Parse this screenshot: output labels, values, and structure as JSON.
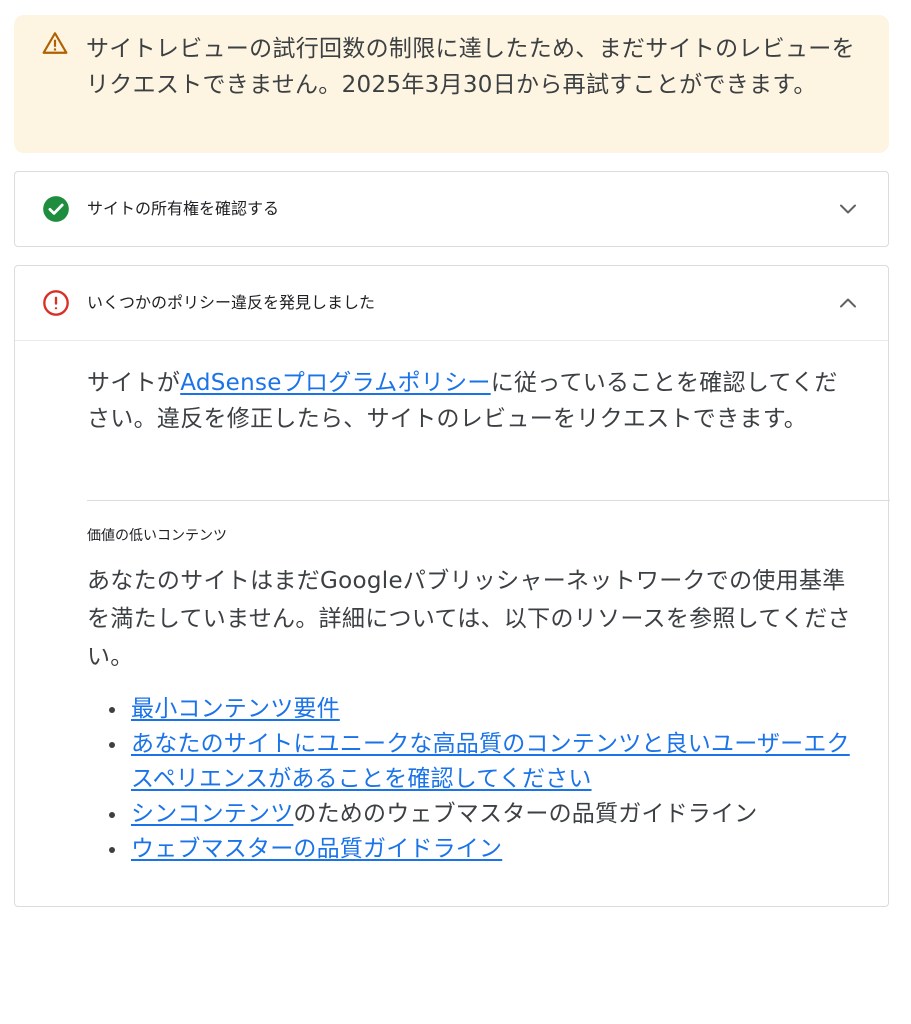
{
  "banner": {
    "icon": "warning-triangle-icon",
    "text": "サイトレビューの試行回数の制限に達したため、まだサイトのレビューをリクエストできません。2025年3月30日から再試すことができます。",
    "color": "#fdf5e1",
    "icon_color": "#b06000"
  },
  "ownership_panel": {
    "icon": "check-circle-icon",
    "icon_color": "#1e8e3e",
    "title": "サイトの所有権を確認する",
    "chevron": "chevron-down-icon"
  },
  "policy_panel": {
    "icon": "error-circle-icon",
    "icon_color": "#d93025",
    "title": "いくつかのポリシー違反を発見しました",
    "chevron": "chevron-up-icon",
    "intro_prefix": "サイトが",
    "intro_link": "AdSenseプログラムポリシー",
    "intro_suffix": "に従っていることを確認してください。違反を修正したら、サイトのレビューをリクエストできます。",
    "section": {
      "label": "価値の低いコンテンツ",
      "text": "あなたのサイトはまだGoogleパブリッシャーネットワークでの使用基準を満たしていません。詳細については、以下のリソースを参照してください。",
      "links": [
        {
          "label": "最小コンテンツ要件",
          "suffix": ""
        },
        {
          "label": "あなたのサイトにユニークな高品質のコンテンツと良いユーザーエクスペリエンスがあることを確認してください",
          "suffix": ""
        },
        {
          "label": "シンコンテンツ",
          "suffix": "のためのウェブマスターの品質ガイドライン"
        },
        {
          "label": "ウェブマスターの品質ガイドライン",
          "suffix": ""
        }
      ]
    }
  },
  "link_color": "#1a73e8"
}
